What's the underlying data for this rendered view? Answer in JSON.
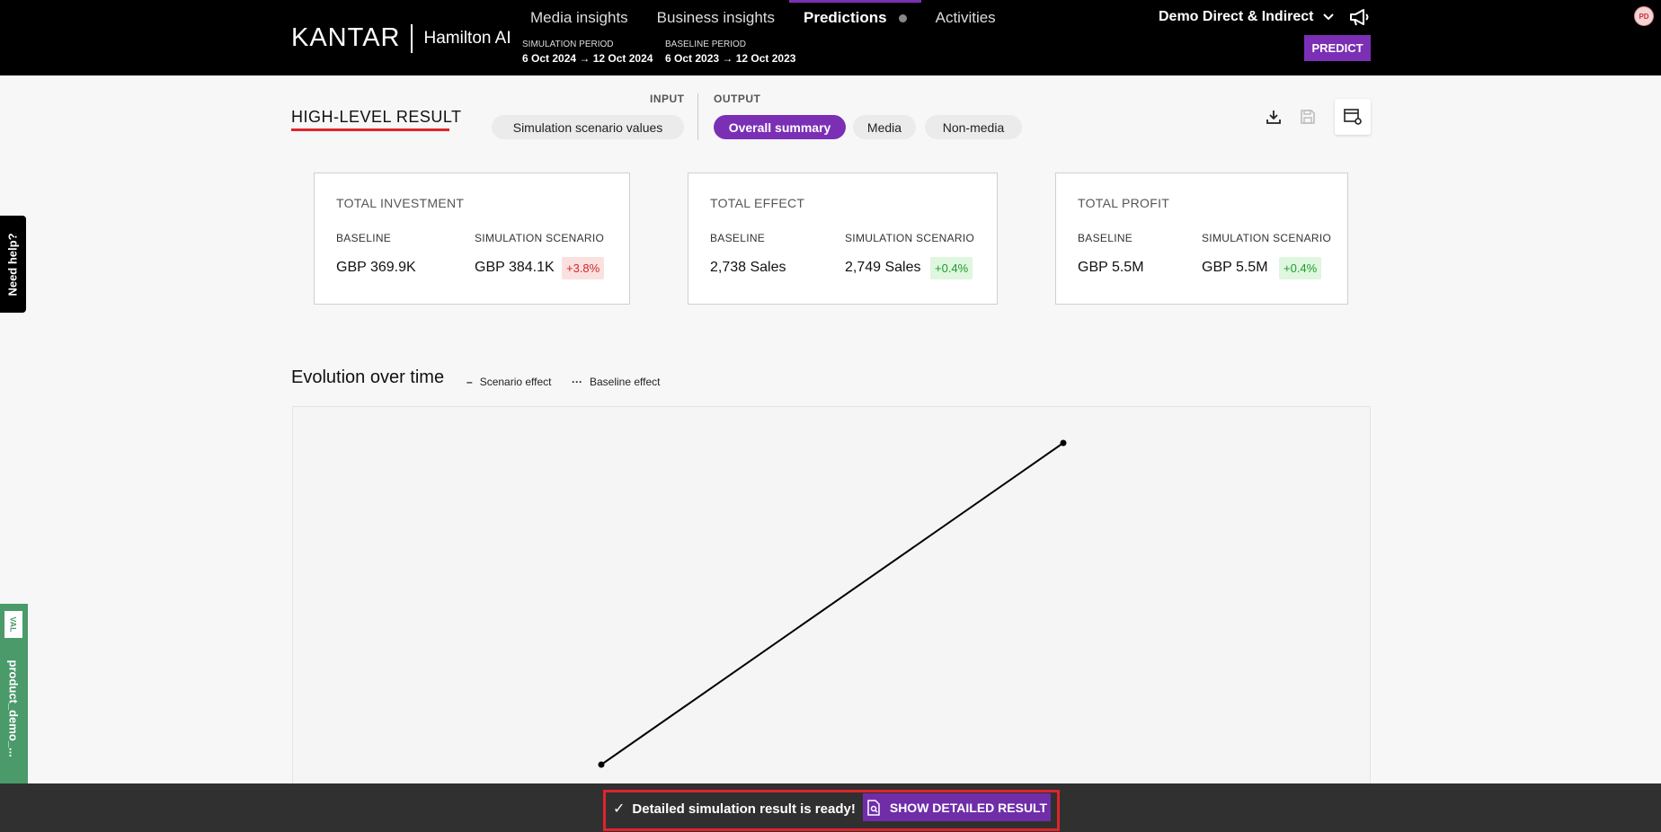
{
  "header": {
    "logo_brand": "KANTAR",
    "logo_product": "Hamilton AI",
    "nav": [
      {
        "label": "Media insights"
      },
      {
        "label": "Business insights"
      },
      {
        "label": "Predictions"
      },
      {
        "label": "Activities"
      }
    ],
    "active_nav": "Predictions",
    "simulation_period_label": "SIMULATION PERIOD",
    "simulation_period_value": "6 Oct 2024 → 12 Oct 2024",
    "baseline_period_label": "BASELINE PERIOD",
    "baseline_period_value": "6 Oct 2023 → 12 Oct 2023",
    "client_selector": "Demo Direct & Indirect",
    "predict_label": "PREDICT",
    "avatar_initials": "PD",
    "icons": [
      "chevron-down-icon",
      "megaphone-icon"
    ]
  },
  "toolbar": {
    "title": "HIGH-LEVEL RESULT",
    "input_label": "INPUT",
    "output_label": "OUTPUT",
    "input_tabs": [
      "Simulation scenario values"
    ],
    "output_tabs": [
      "Overall summary",
      "Media",
      "Non-media"
    ],
    "active_output_tab": "Overall summary",
    "icons": [
      "download-icon",
      "save-icon",
      "table-settings-icon"
    ]
  },
  "cards": [
    {
      "title": "TOTAL INVESTMENT",
      "baseline_label": "BASELINE",
      "scenario_label": "SIMULATION SCENARIO",
      "baseline_value": "GBP 369.9K",
      "scenario_value": "GBP 384.1K",
      "change": "+3.8%",
      "change_color": "#d12a2a"
    },
    {
      "title": "TOTAL EFFECT",
      "baseline_label": "BASELINE",
      "scenario_label": "SIMULATION SCENARIO",
      "baseline_value": "2,738 Sales",
      "scenario_value": "2,749 Sales",
      "change": "+0.4%",
      "change_color": "#1f9c2e"
    },
    {
      "title": "TOTAL PROFIT",
      "baseline_label": "BASELINE",
      "scenario_label": "SIMULATION SCENARIO",
      "baseline_value": "GBP 5.5M",
      "scenario_value": "GBP 5.5M",
      "change": "+0.4%",
      "change_color": "#1f9c2e"
    }
  ],
  "evolution": {
    "title": "Evolution over time",
    "legend_scenario": "Scenario effect",
    "legend_baseline": "Baseline effect"
  },
  "chart_data": {
    "type": "line",
    "title": "Evolution over time",
    "series": [
      {
        "name": "Scenario effect",
        "style": "solid",
        "values": [
          0,
          1
        ]
      },
      {
        "name": "Baseline effect",
        "style": "dotted",
        "values": [
          0,
          1
        ]
      }
    ],
    "x": [
      0,
      1
    ],
    "grid": false,
    "legend": "top-left"
  },
  "side": {
    "need_help": "Need help?",
    "env_badge": "VAL",
    "env_name": "product_demo_..."
  },
  "notification": {
    "message": "Detailed simulation result is ready!",
    "button_label": "SHOW DETAILED RESULT"
  },
  "colors": {
    "accent": "#7b2fb5",
    "negative": "#d12a2a",
    "positive": "#1f9c2e",
    "highlight": "#e0242b"
  }
}
